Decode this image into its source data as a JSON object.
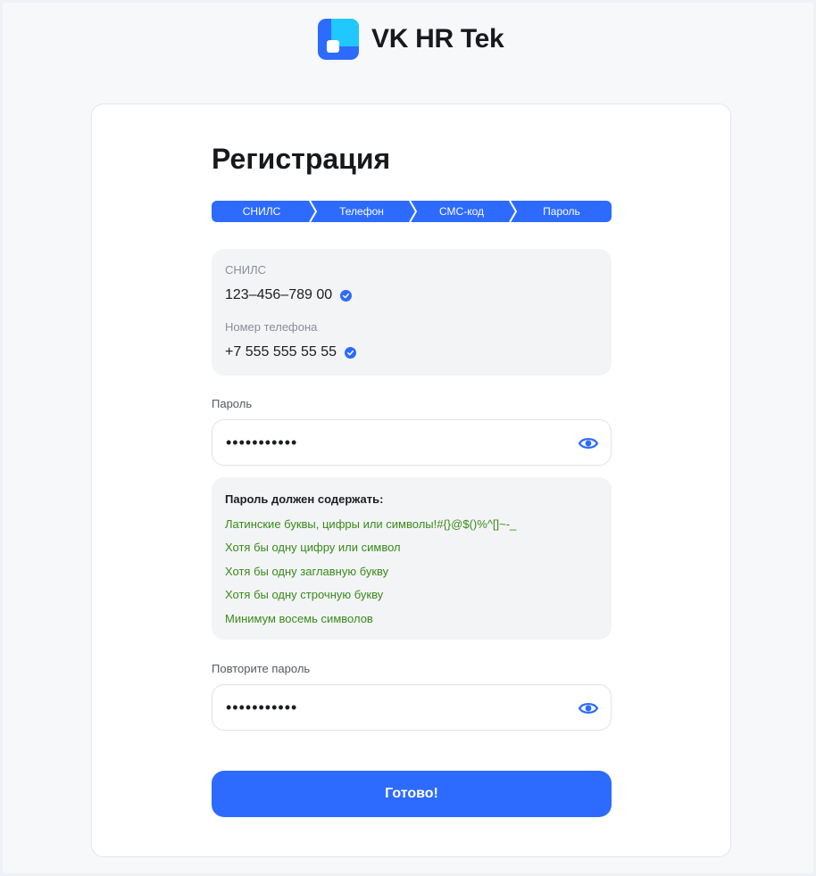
{
  "brand": {
    "name": "VK HR Tek",
    "colors": {
      "primary": "#2d6bff",
      "logo_light": "#20c8ff",
      "success": "#3a8a1a"
    }
  },
  "page": {
    "title": "Регистрация"
  },
  "steps": [
    {
      "label": "СНИЛС"
    },
    {
      "label": "Телефон"
    },
    {
      "label": "СМС-код"
    },
    {
      "label": "Пароль"
    }
  ],
  "summary": {
    "snils_label": "СНИЛС",
    "snils_value": "123–456–789 00",
    "phone_label": "Номер телефона",
    "phone_value": "+7 555 555 55 55",
    "verified_icon": "check-circle-icon"
  },
  "password": {
    "label": "Пароль",
    "value": "•••••••••••",
    "toggle_icon": "eye-icon"
  },
  "requirements": {
    "title": "Пароль должен содержать:",
    "items": [
      "Латинские буквы, цифры или символы!#{}@$()%^[]~-_",
      "Хотя бы одну цифру или символ",
      "Хотя бы одну заглавную букву",
      "Хотя бы одну строчную букву",
      "Минимум восемь символов"
    ]
  },
  "confirm": {
    "label": "Повторите пароль",
    "value": "•••••••••••",
    "toggle_icon": "eye-icon"
  },
  "submit": {
    "label": "Готово!"
  }
}
